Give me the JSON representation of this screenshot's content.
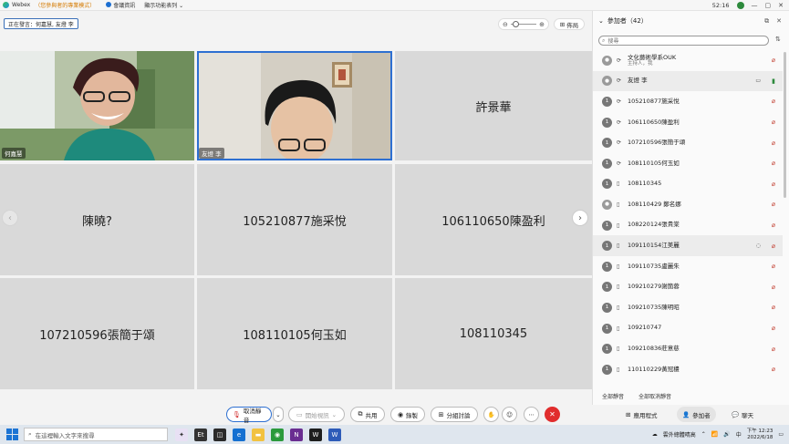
{
  "titlebar": {
    "app": "Webex",
    "mode": "（您參與者的專業模式）",
    "menu_info": "會議資訊",
    "menu_display": "顯示功能表列",
    "time": "52:16"
  },
  "stage": {
    "speaking_label": "正在發言：何嘉慧, 友燈 李",
    "layout_label": "佈局",
    "zoom_minus": "⊖",
    "zoom_plus": "⊕"
  },
  "tiles": [
    {
      "label": "",
      "name_tag": "何嘉慧",
      "video": true,
      "selected": false
    },
    {
      "label": "",
      "name_tag": "友燈 李",
      "video": true,
      "selected": true
    },
    {
      "label": "許景華",
      "video": false
    },
    {
      "label": "陳曉?",
      "video": false
    },
    {
      "label": "105210877施采悅",
      "video": false
    },
    {
      "label": "106110650陳盈利",
      "video": false
    },
    {
      "label": "107210596張簡于頌",
      "video": false
    },
    {
      "label": "108110105何玉如",
      "video": false
    },
    {
      "label": "108110345",
      "video": false
    }
  ],
  "controls": {
    "mute_label": "取消靜音",
    "video_label": "開始視訊",
    "share_label": "共用",
    "record_label": "錄製",
    "breakout_label": "分組討論",
    "apps_label": "應用程式",
    "participants_label": "參加者",
    "chat_label": "聊天"
  },
  "panel": {
    "title": "參加者（42）",
    "search_placeholder": "搜尋",
    "participants": [
      {
        "name": "文化藝術學系OUK",
        "sub": "主持人，我",
        "avatar": "",
        "device": "⟳",
        "mic": "muted"
      },
      {
        "name": "友燈 李",
        "sub": "",
        "avatar": "",
        "device": "⟳",
        "mic": "on",
        "camera": true,
        "highlight": true
      },
      {
        "name": "105210877施采悅",
        "sub": "",
        "avatar": "1",
        "device": "⟳",
        "mic": "muted"
      },
      {
        "name": "106110650陳盈利",
        "sub": "",
        "avatar": "1",
        "device": "⟳",
        "mic": "muted"
      },
      {
        "name": "107210596張簡于頌",
        "sub": "",
        "avatar": "1",
        "device": "⟳",
        "mic": "muted"
      },
      {
        "name": "108110105何玉如",
        "sub": "",
        "avatar": "1",
        "device": "⟳",
        "mic": "muted"
      },
      {
        "name": "108110345",
        "sub": "",
        "avatar": "1",
        "device": "▯",
        "mic": "muted"
      },
      {
        "name": "108110429 鄭名娜",
        "sub": "",
        "avatar": "",
        "device": "▯",
        "mic": "muted"
      },
      {
        "name": "108220124張貴棠",
        "sub": "",
        "avatar": "1",
        "device": "▯",
        "mic": "muted"
      },
      {
        "name": "109110154江美麗",
        "sub": "",
        "avatar": "1",
        "device": "▯",
        "mic": "muted",
        "chat": true,
        "highlight": true
      },
      {
        "name": "109110735盧麗朱",
        "sub": "",
        "avatar": "1",
        "device": "▯",
        "mic": "muted"
      },
      {
        "name": "109210279謝箇蓉",
        "sub": "",
        "avatar": "1",
        "device": "▯",
        "mic": "muted"
      },
      {
        "name": "109210735陳明昭",
        "sub": "",
        "avatar": "1",
        "device": "▯",
        "mic": "muted"
      },
      {
        "name": "109210747",
        "sub": "",
        "avatar": "1",
        "device": "▯",
        "mic": "muted"
      },
      {
        "name": "109210836莊意慈",
        "sub": "",
        "avatar": "1",
        "device": "▯",
        "mic": "muted"
      },
      {
        "name": "110110229黃冠穠",
        "sub": "",
        "avatar": "1",
        "device": "▯",
        "mic": "muted"
      }
    ],
    "mute_all": "全部靜音",
    "unmute_all": "全部取消靜音"
  },
  "taskbar": {
    "search_placeholder": "在這裡輸入文字來搜尋",
    "weather": "雲外總體晴高",
    "time": "下午 12:23",
    "date": "2022/6/18"
  }
}
